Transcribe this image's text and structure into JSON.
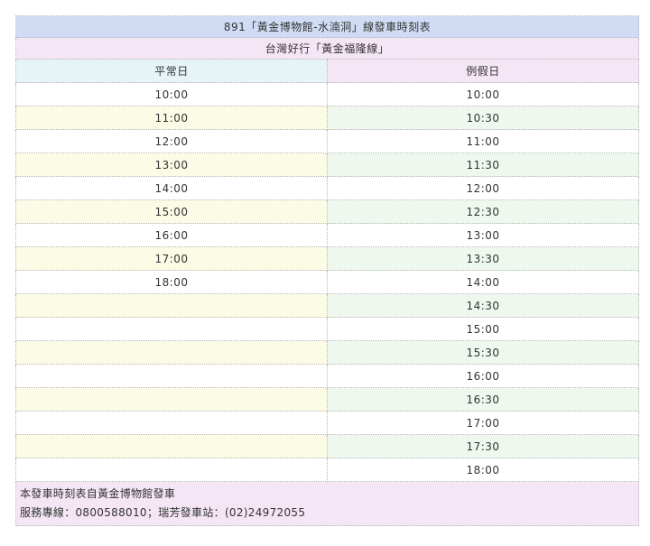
{
  "title": "891「黃金博物館-水湳洞」線發車時刻表",
  "subtitle": "台灣好行「黃金福隆線」",
  "columns": {
    "weekday": "平常日",
    "holiday": "例假日"
  },
  "weekday_times": [
    "10:00",
    "11:00",
    "12:00",
    "13:00",
    "14:00",
    "15:00",
    "16:00",
    "17:00",
    "18:00"
  ],
  "holiday_times": [
    "10:00",
    "10:30",
    "11:00",
    "11:30",
    "12:00",
    "12:30",
    "13:00",
    "13:30",
    "14:00",
    "14:30",
    "15:00",
    "15:30",
    "16:00",
    "16:30",
    "17:00",
    "17:30",
    "18:00"
  ],
  "footer": {
    "line1": "本發車時刻表自黃金博物館發車",
    "line2": "服務專線：0800588010；瑞芳發車站：(02)24972055"
  }
}
